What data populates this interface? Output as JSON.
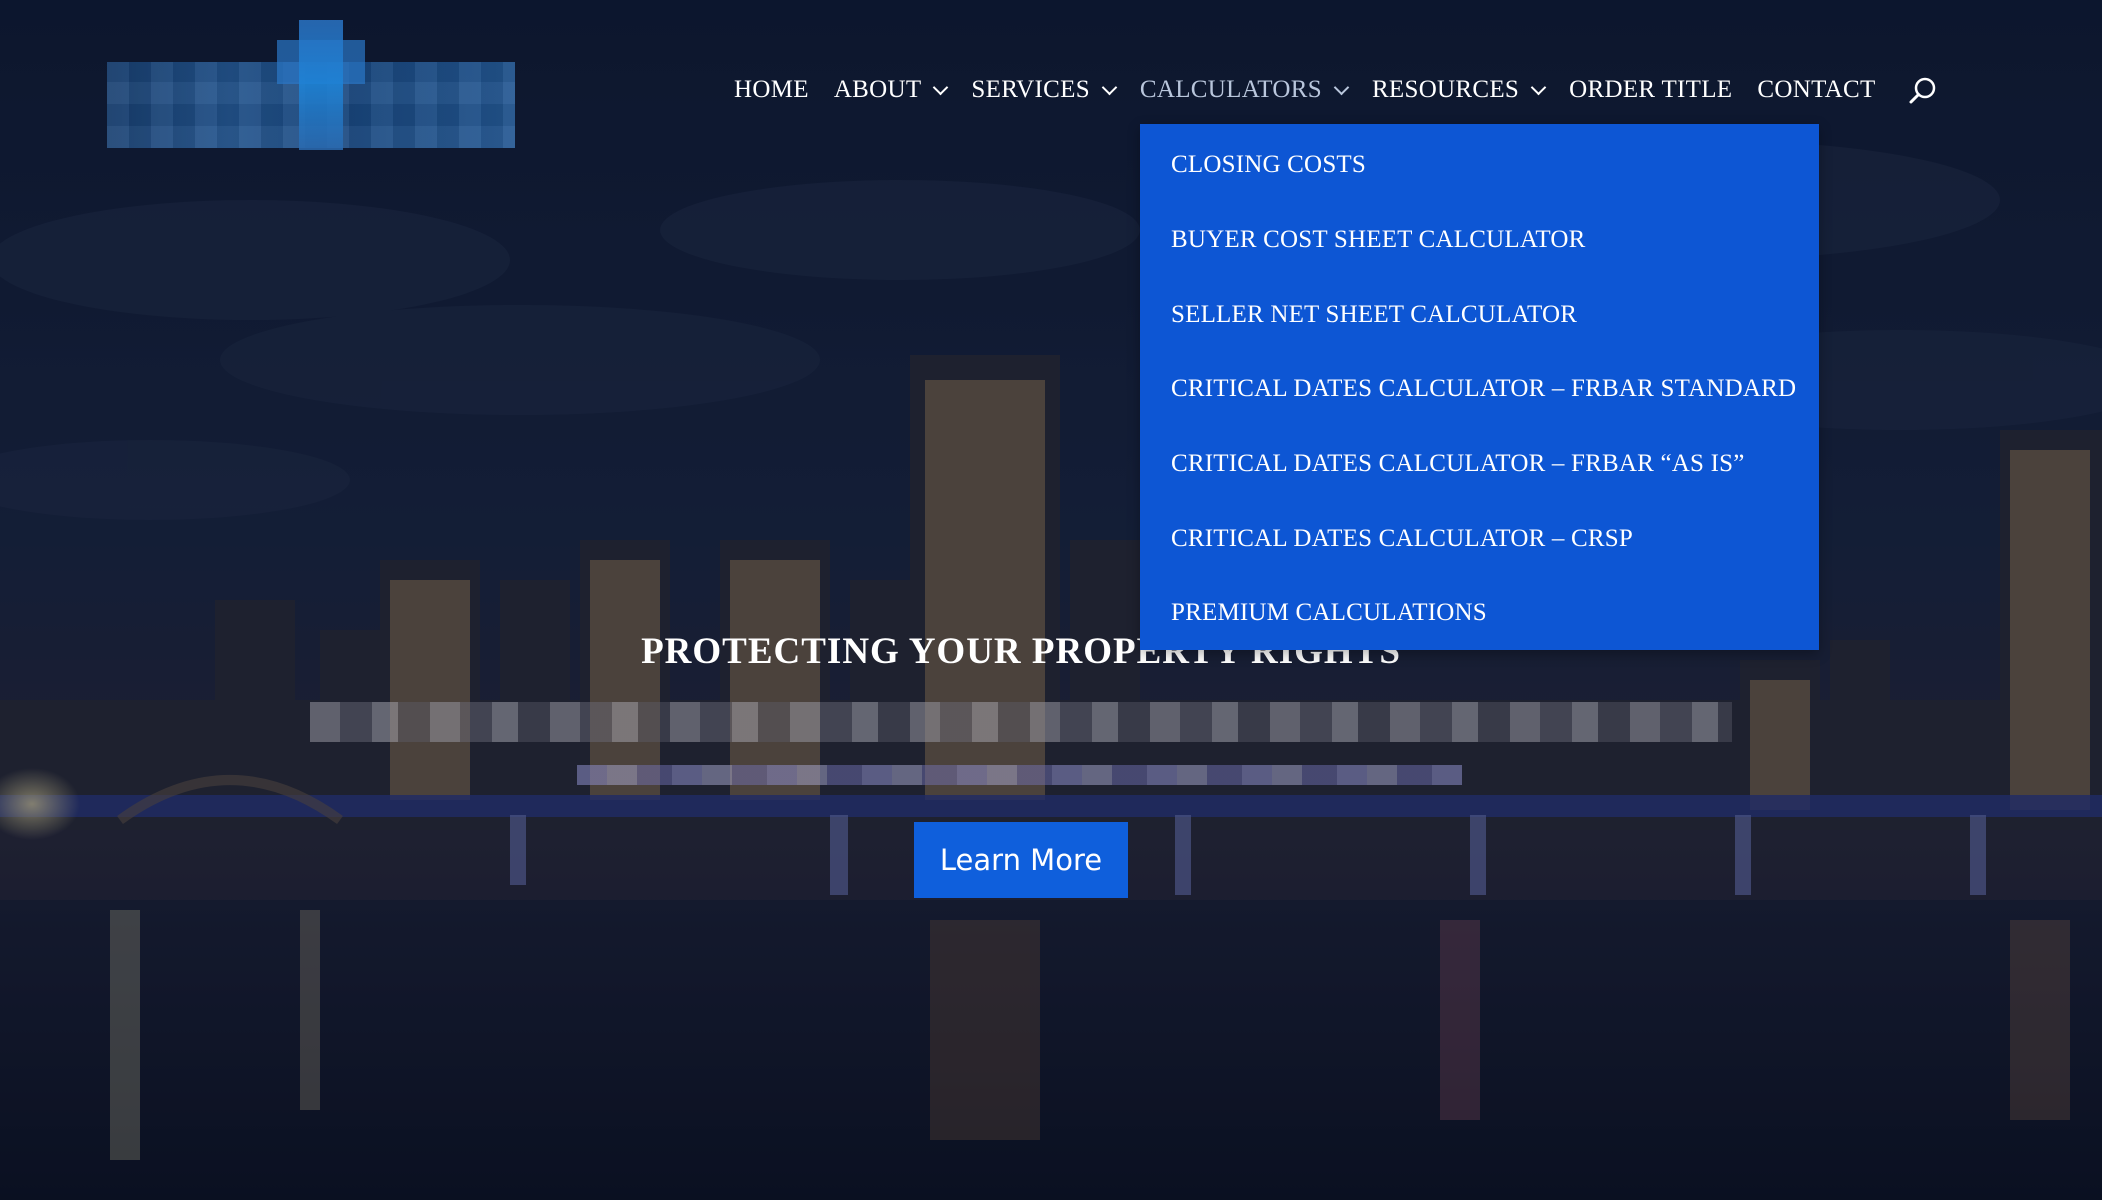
{
  "nav": {
    "items": [
      {
        "label": "HOME",
        "has_dropdown": false,
        "active": false
      },
      {
        "label": "ABOUT",
        "has_dropdown": true,
        "active": false
      },
      {
        "label": "SERVICES",
        "has_dropdown": true,
        "active": false
      },
      {
        "label": "CALCULATORS",
        "has_dropdown": true,
        "active": true
      },
      {
        "label": "RESOURCES",
        "has_dropdown": true,
        "active": false
      },
      {
        "label": "ORDER TITLE",
        "has_dropdown": false,
        "active": false
      },
      {
        "label": "CONTACT",
        "has_dropdown": false,
        "active": false
      }
    ],
    "search_icon": "search-icon"
  },
  "dropdown": {
    "items": [
      "CLOSING COSTS",
      "BUYER COST SHEET CALCULATOR",
      "SELLER NET SHEET CALCULATOR",
      "CRITICAL DATES CALCULATOR – FRBAR STANDARD",
      "CRITICAL DATES CALCULATOR – FRBAR “AS IS”",
      "CRITICAL DATES CALCULATOR – CRSP",
      "PREMIUM CALCULATIONS"
    ]
  },
  "hero": {
    "title": "PROTECTING YOUR PROPERTY RIGHTS",
    "cta_label": "Learn More"
  },
  "colors": {
    "dropdown_bg": "#0d56d4",
    "button_bg": "#0f5fdc",
    "active_nav": "#b9c6dc"
  }
}
